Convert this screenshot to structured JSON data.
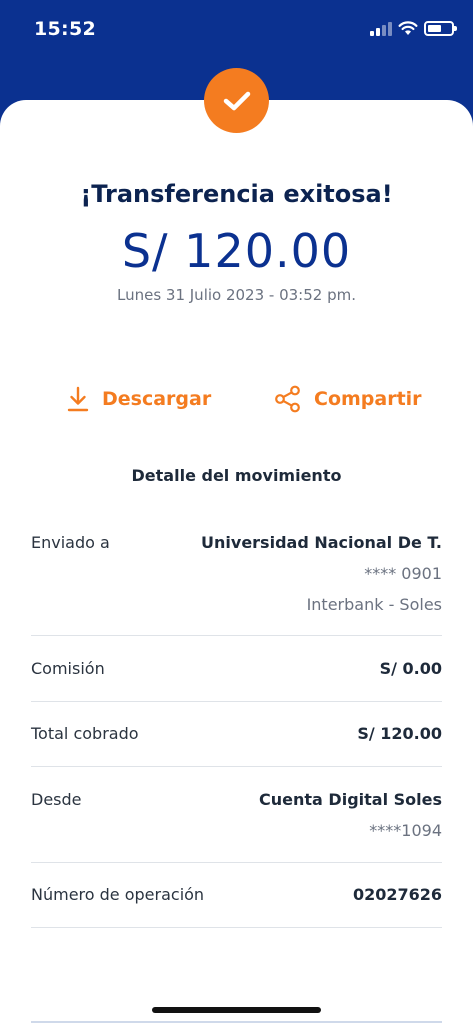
{
  "status_bar": {
    "time": "15:52"
  },
  "colors": {
    "brand_blue": "#0b3190",
    "accent_orange": "#f47c20"
  },
  "header": {
    "success_icon": "check-icon",
    "title": "¡Transferencia exitosa!",
    "amount": "S/ 120.00",
    "datetime": "Lunes 31 Julio 2023 - 03:52 pm."
  },
  "actions": {
    "download_label": "Descargar",
    "download_icon": "download-icon",
    "share_label": "Compartir",
    "share_icon": "share-icon"
  },
  "detail": {
    "title": "Detalle del movimiento",
    "rows": [
      {
        "label": "Enviado a",
        "value": "Universidad Nacional De T.",
        "sub1": "**** 0901",
        "sub2": "Interbank - Soles"
      },
      {
        "label": "Comisión",
        "value": "S/ 0.00"
      },
      {
        "label": "Total cobrado",
        "value": "S/ 120.00"
      },
      {
        "label": "Desde",
        "value": "Cuenta Digital Soles",
        "sub1": "****1094"
      },
      {
        "label": "Número de operación",
        "value": "02027626"
      }
    ]
  }
}
